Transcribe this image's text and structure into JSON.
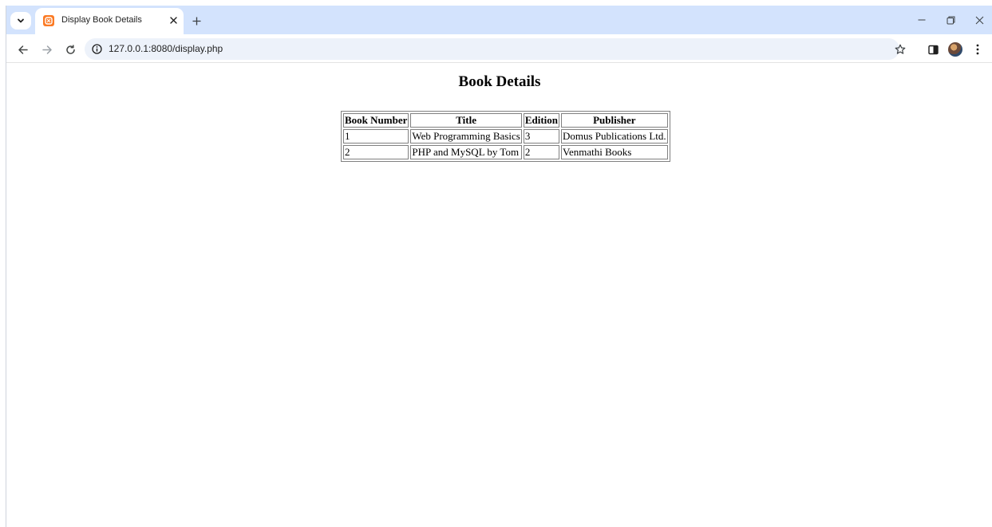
{
  "browser": {
    "tab": {
      "title": "Display Book Details",
      "favicon": "xampp-icon"
    },
    "address_bar": {
      "url": "127.0.0.1:8080/display.php"
    },
    "icons": {
      "tab_search": "chevron-down-icon",
      "tab_close": "close-icon",
      "new_tab": "plus-icon",
      "minimize": "minimize-icon",
      "restore": "restore-icon",
      "close_window": "close-icon",
      "back": "back-arrow-icon",
      "forward": "forward-arrow-icon",
      "reload": "reload-icon",
      "site_info": "info-icon",
      "bookmark": "star-icon",
      "side_panel": "side-panel-icon",
      "profile": "avatar",
      "menu": "kebab-menu-icon"
    },
    "colors": {
      "tabstrip_bg": "#d3e3fd",
      "omnibox_bg": "#edf2fa",
      "favicon": "#fb7a24"
    }
  },
  "page": {
    "heading": "Book Details",
    "table": {
      "headers": [
        "Book Number",
        "Title",
        "Edition",
        "Publisher"
      ],
      "rows": [
        [
          "1",
          "Web Programming Basics",
          "3",
          "Domus Publications Ltd."
        ],
        [
          "2",
          "PHP and MySQL by Tom",
          "2",
          "Venmathi Books"
        ]
      ]
    }
  }
}
